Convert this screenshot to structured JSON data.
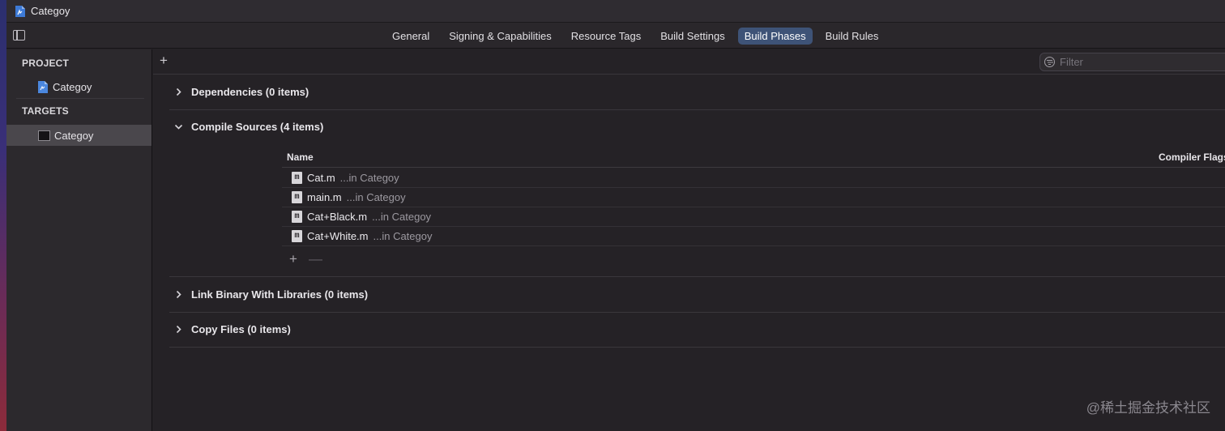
{
  "window": {
    "title": "Categoy"
  },
  "tabs": [
    {
      "label": "General",
      "active": false
    },
    {
      "label": "Signing & Capabilities",
      "active": false
    },
    {
      "label": "Resource Tags",
      "active": false
    },
    {
      "label": "Build Settings",
      "active": false
    },
    {
      "label": "Build Phases",
      "active": true
    },
    {
      "label": "Build Rules",
      "active": false
    }
  ],
  "navigator": {
    "project_header": "PROJECT",
    "project_item": "Categoy",
    "targets_header": "TARGETS",
    "target_item": "Categoy"
  },
  "toolbar": {
    "add_label": "+",
    "filter_placeholder": "Filter"
  },
  "phases": {
    "dependencies": "Dependencies (0 items)",
    "compile_sources": "Compile Sources (4 items)",
    "link_binary": "Link Binary With Libraries (0 items)",
    "copy_files": "Copy Files (0 items)"
  },
  "compile_table": {
    "col_name": "Name",
    "col_flags": "Compiler Flags",
    "files": [
      {
        "icon": "m",
        "name": "Cat.m",
        "location": "...in Categoy"
      },
      {
        "icon": "m",
        "name": "main.m",
        "location": "...in Categoy"
      },
      {
        "icon": "m",
        "name": "Cat+Black.m",
        "location": "...in Categoy"
      },
      {
        "icon": "m",
        "name": "Cat+White.m",
        "location": "...in Categoy"
      }
    ],
    "add_label": "+",
    "remove_label": "—"
  },
  "watermark": "@稀土掘金技术社区",
  "colors": {
    "active_tab": "#3e5377",
    "background": "#252226",
    "sidebar": "#2c292d"
  }
}
